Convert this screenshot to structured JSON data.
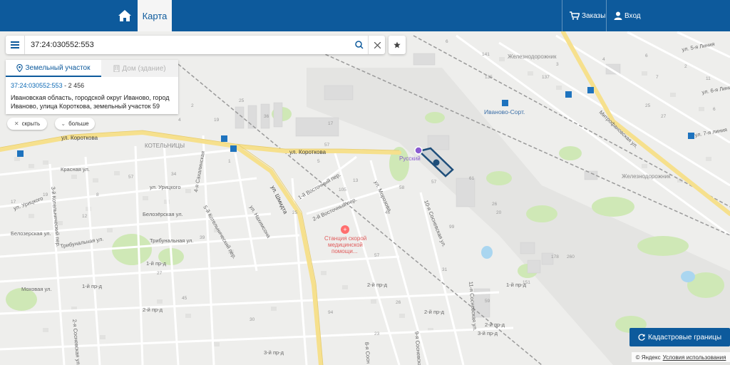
{
  "header": {
    "tab_map": "Карта",
    "orders": "Заказы",
    "login": "Вход"
  },
  "search": {
    "value": "37:24:030552:553"
  },
  "panel": {
    "tab_land": "Земельный участок",
    "tab_house": "Дом (здание)",
    "cad_number": "37:24:030552:553",
    "cad_area": " - 2 456",
    "address": "Ивановская область, городской округ Иваново, город Иваново, улица Короткова, земельный участок 59",
    "hide_label": "скрыть",
    "more_label": "больше"
  },
  "map": {
    "labels": {
      "zheleznodorozhnik1": "Железнодорожник",
      "zheleznodorozhnik2": "Железнодорожник",
      "ivanovo_sort": "Иваново-Сорт.",
      "kotelnitsy": "КОТЕЛЬНИЦЫ",
      "korotkova_w": "ул. Короткова",
      "korotkova_mid": "ул. Короткова",
      "shmidta": "ул. Шмидта",
      "russkiy": "Русский",
      "ambulance": "Станция скорой медицинской помощи...",
      "ambulance_1": "Станция скорой",
      "ambulance_2": "медицинской",
      "ambulance_3": "помощи...",
      "mitrofanovskaya": "Митрофановская ул.",
      "krasnaya": "Красная ул.",
      "uritskogo": "ул. Урицкого",
      "belozerskaya_w": "Белозерская ул.",
      "belozerskaya_e": "Белозёрская ул.",
      "tribunalnaya_w": "Трибунальная ул.",
      "tribunalnaya_e": "Трибунальная ул.",
      "mokovaya": "Моховая ул.",
      "vostochny1": "1-й Восточный пер.",
      "vostochny2": "2-й Восточный пер.",
      "morozova": "ул. Морозова",
      "nakhimsona": "ул. Нахимсона",
      "kotelnichesky5": "5-й Котельнический пер.",
      "sakhalinskaya": "4-я Сахалинская",
      "kotelnichesky3": "3-й Котельнический пер.",
      "sosnevskaya10": "10-я Сосневская ул.",
      "sosnevskaya11": "11-я Сосневская ул.",
      "sosnevskaya9": "9-я Сосневская",
      "sosnevskaya8": "8-я Сосн",
      "sosnevskaya2": "2-я Сосневская ул.",
      "line5": "ул. 5-я Линия",
      "line6": "ул. 6-я Линия",
      "line7": "ул. 7-я линия",
      "pr1": "1-й пр-д",
      "pr1b": "1-й пр-д",
      "pr2a": "2-й пр-д",
      "pr2b": "2-й пр-д",
      "pr3a": "3-й пр-д",
      "pr3b": "3-й пр-д",
      "pr2c": "2-й пр-д",
      "pr2d": "2-й пр-д",
      "pr1c": "1-й пр-д"
    },
    "house_numbers": [
      "141",
      "137",
      "135",
      "6",
      "6",
      "7",
      "4",
      "3",
      "2",
      "11",
      "6",
      "25",
      "27",
      "17",
      "57",
      "5",
      "58",
      "57",
      "260",
      "178",
      "26",
      "20",
      "151",
      "61",
      "59",
      "94",
      "23",
      "31",
      "26",
      "45",
      "39",
      "34",
      "57",
      "1",
      "25",
      "105",
      "99",
      "46",
      "57",
      "27",
      "19",
      "17",
      "8",
      "12",
      "30",
      "13",
      "25",
      "36",
      "2",
      "4",
      "19",
      "17"
    ]
  },
  "cad_button": "Кадастровые границы",
  "copyright": {
    "yandex": "© Яндекс",
    "terms": "Условия использования"
  },
  "colors": {
    "header": "#0d5a9c",
    "road_major": "#f6e08d",
    "parcel": "#1e4e7a",
    "park": "#cfe8b6",
    "water": "#aad6f0"
  }
}
